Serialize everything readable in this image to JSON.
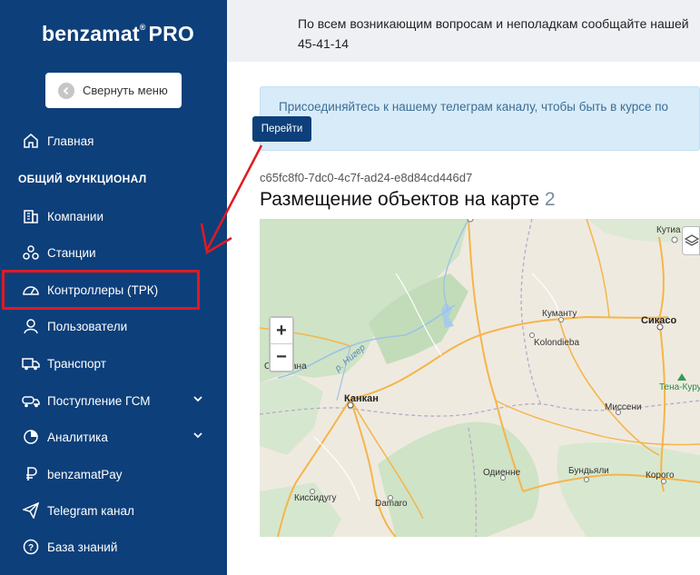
{
  "brand": {
    "name": "benzamat",
    "suffix": "PRO"
  },
  "sidebar": {
    "collapse_label": "Свернуть меню",
    "home_label": "Главная",
    "section_title": "ОБЩИЙ ФУНКЦИОНАЛ",
    "items": [
      {
        "label": "Компании",
        "icon": "building-icon"
      },
      {
        "label": "Станции",
        "icon": "network-icon"
      },
      {
        "label": "Контроллеры (ТРК)",
        "icon": "gauge-icon"
      },
      {
        "label": "Пользователи",
        "icon": "user-icon"
      },
      {
        "label": "Транспорт",
        "icon": "truck-icon"
      },
      {
        "label": "Поступление ГСМ",
        "icon": "fuel-truck-icon"
      },
      {
        "label": "Аналитика",
        "icon": "pie-chart-icon"
      },
      {
        "label": "benzamatPay",
        "icon": "ruble-icon"
      },
      {
        "label": "Telegram канал",
        "icon": "paper-plane-icon"
      },
      {
        "label": "База знаний",
        "icon": "help-circle-icon"
      }
    ]
  },
  "topbar": {
    "line1": "По всем возникающим вопросам и неполадкам сообщайте нашей",
    "line2": "45-41-14"
  },
  "alert": {
    "text": "Присоединяйтесь к нашему телеграм каналу, чтобы быть в курсе по",
    "button_label": "Перейти"
  },
  "map_section": {
    "object_id": "c65fc8f0-7dc0-4c7f-ad24-e8d84cd446d7",
    "title": "Размещение объектов на карте",
    "count": "2",
    "zoom_in": "+",
    "zoom_out": "−",
    "cities": {
      "kutiala": "Кутиа",
      "kumantu": "Куманту",
      "sikasso": "Сикасо",
      "kolondieba": "Kolondieba",
      "tena_kuru": "Тена-Куру",
      "missenі": "Миссени",
      "kankan": "Канкан",
      "odienne": "Одиенне",
      "boundiali": "Бундьяли",
      "korogo": "Корого",
      "kissidugu": "Кисcидугу",
      "damaro": "Damaro",
      "siguiri": "Сиг",
      "siguiri2": "ана",
      "river": "р. Нигер"
    }
  },
  "colors": {
    "sidebar": "#0d3f7a",
    "accent": "#0d3f7a",
    "highlight": "#e01a22",
    "alert_bg": "#d8ebf8"
  }
}
